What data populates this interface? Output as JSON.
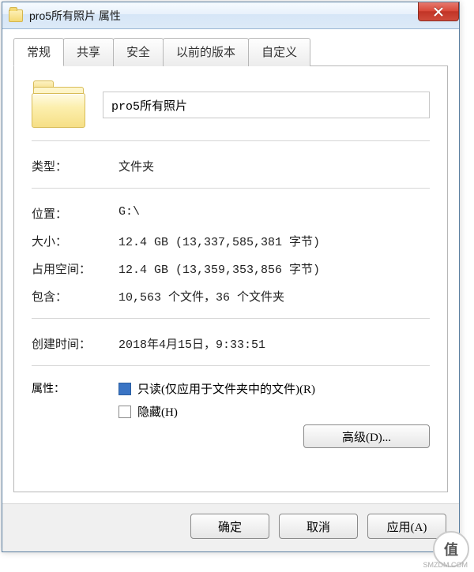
{
  "titlebar": {
    "title": "pro5所有照片 属性"
  },
  "tabs": {
    "general": "常规",
    "sharing": "共享",
    "security": "安全",
    "previous": "以前的版本",
    "customize": "自定义"
  },
  "folder": {
    "name": "pro5所有照片"
  },
  "labels": {
    "type": "类型：",
    "location": "位置：",
    "size": "大小：",
    "size_on_disk": "占用空间：",
    "contains": "包含：",
    "created": "创建时间：",
    "attributes": "属性："
  },
  "values": {
    "type": "文件夹",
    "location": "G:\\",
    "size": "12.4 GB (13,337,585,381 字节)",
    "size_on_disk": "12.4 GB (13,359,353,856 字节)",
    "contains": "10,563 个文件，36 个文件夹",
    "created": "2018年4月15日，9:33:51"
  },
  "attributes": {
    "readonly_label": "只读(仅应用于文件夹中的文件)(R)",
    "hidden_label": "隐藏(H)",
    "advanced_label": "高级(D)..."
  },
  "buttons": {
    "ok": "确定",
    "cancel": "取消",
    "apply": "应用(A)"
  },
  "watermark": {
    "badge": "值",
    "text": "SMZDM.COM"
  }
}
